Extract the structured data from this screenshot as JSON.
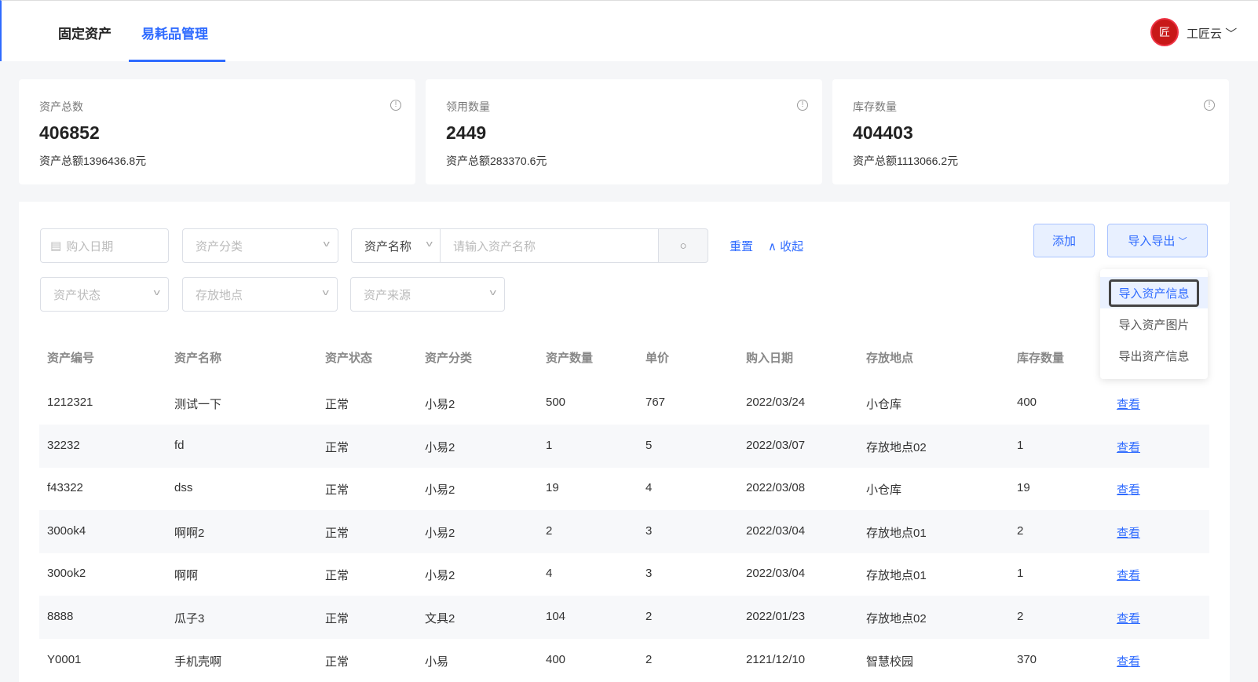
{
  "tabs": [
    {
      "label": "固定资产"
    },
    {
      "label": "易耗品管理"
    }
  ],
  "user": {
    "name": "工匠云",
    "logo_text": "匠"
  },
  "cards": [
    {
      "label": "资产总数",
      "value": "406852",
      "sub": "资产总额1396436.8元"
    },
    {
      "label": "领用数量",
      "value": "2449",
      "sub": "资产总额283370.6元"
    },
    {
      "label": "库存数量",
      "value": "404403",
      "sub": "资产总额1113066.2元"
    }
  ],
  "filters": {
    "date": "购入日期",
    "category": "资产分类",
    "name_select": "资产名称",
    "name_placeholder": "请输入资产名称",
    "status": "资产状态",
    "location": "存放地点",
    "source": "资产来源",
    "reset": "重置",
    "collapse": "收起"
  },
  "actions": {
    "add": "添加",
    "import_export": "导入导出"
  },
  "menu": [
    "导入资产信息",
    "导入资产图片",
    "导出资产信息"
  ],
  "table": {
    "headers": [
      "资产编号",
      "资产名称",
      "资产状态",
      "资产分类",
      "资产数量",
      "单价",
      "购入日期",
      "存放地点",
      "库存数量"
    ],
    "rows": [
      [
        "1212321",
        "测试一下",
        "正常",
        "小易2",
        "500",
        "767",
        "2022/03/24",
        "小仓库",
        "400",
        "查看"
      ],
      [
        "32232",
        "fd",
        "正常",
        "小易2",
        "1",
        "5",
        "2022/03/07",
        "存放地点02",
        "1",
        "查看"
      ],
      [
        "f43322",
        "dss",
        "正常",
        "小易2",
        "19",
        "4",
        "2022/03/08",
        "小仓库",
        "19",
        "查看"
      ],
      [
        "300ok4",
        "啊啊2",
        "正常",
        "小易2",
        "2",
        "3",
        "2022/03/04",
        "存放地点01",
        "2",
        "查看"
      ],
      [
        "300ok2",
        "啊啊",
        "正常",
        "小易2",
        "4",
        "3",
        "2022/03/04",
        "存放地点01",
        "1",
        "查看"
      ],
      [
        "8888",
        "瓜子3",
        "正常",
        "文具2",
        "104",
        "2",
        "2022/01/23",
        "存放地点02",
        "2",
        "查看"
      ],
      [
        "Y0001",
        "手机壳啊",
        "正常",
        "小易",
        "400",
        "2",
        "2121/12/10",
        "智慧校园",
        "370",
        "查看"
      ]
    ]
  }
}
